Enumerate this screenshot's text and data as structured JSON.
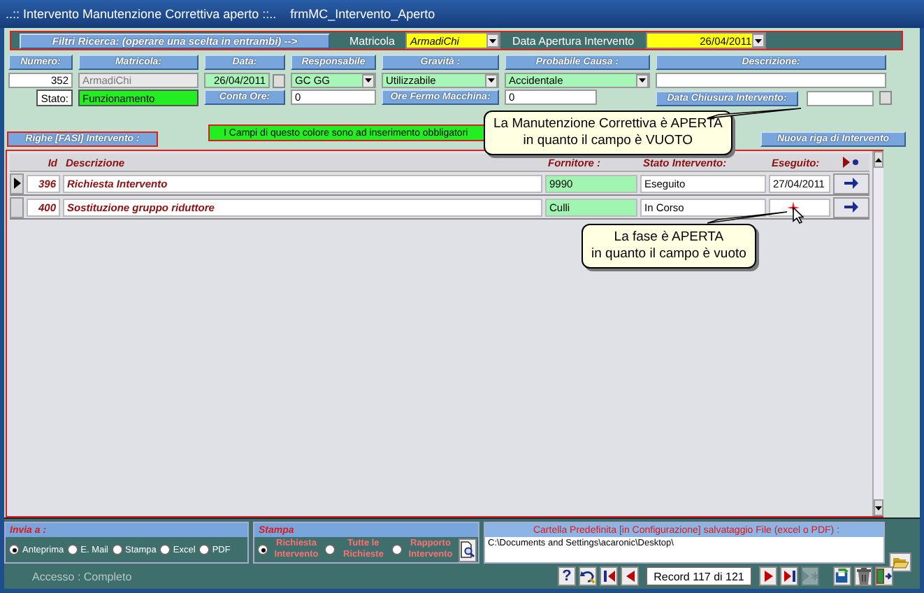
{
  "window": {
    "title": "..::  Intervento Manutenzione Correttiva aperto  ::..",
    "form_name": "frmMC_Intervento_Aperto"
  },
  "filter_bar": {
    "label": "Filtri Ricerca:  (operare una scelta in  entrambi) -->",
    "matricola_label": "Matricola",
    "matricola_value": "ArmadiChi",
    "date_label": "Data Apertura Intervento",
    "date_value": "26/04/2011"
  },
  "header_fields": [
    {
      "label": "Numero:",
      "kind": "number",
      "value": "352",
      "required": false
    },
    {
      "label": "Matricola:",
      "kind": "locked",
      "value": "ArmadiChi",
      "required": false
    },
    {
      "label": "Data:",
      "kind": "date",
      "value": "26/04/2011",
      "required": true
    },
    {
      "label": "Responsabile",
      "kind": "combo",
      "value": "GC GG",
      "required": true
    },
    {
      "label": "Gravità :",
      "kind": "combo",
      "value": "Utilizzabile",
      "required": true
    },
    {
      "label": "Probabile Causa :",
      "kind": "combo",
      "value": "Accidentale",
      "required": true
    },
    {
      "label": "Descrizione:",
      "kind": "text",
      "required": false
    }
  ],
  "status_row": {
    "stato_label": "Stato:",
    "stato_value": "Funzionamento",
    "conta_ore_label": "Conta Ore:",
    "conta_ore_value": "0",
    "ore_fermo_label": "Ore Fermo Macchina:",
    "ore_fermo_value": "0",
    "chiusura_label": "Data Chiusura Intervento:"
  },
  "legend": "I Campi di questo colore sono ad inserimento obbligatori",
  "phases": {
    "label": "Righe [FASI]  Intervento :",
    "new_row_button": "Nuova riga di Intervento",
    "columns": [
      "Id",
      "Descrizione",
      "Fornitore :",
      "Stato Intervento:",
      "Eseguito:"
    ],
    "rows": [
      {
        "selected": true,
        "id": "396",
        "description": "Richiesta Intervento",
        "supplier": "9990",
        "status": "Eseguito",
        "done": "27/04/2011"
      },
      {
        "selected": false,
        "id": "400",
        "description": "Sostituzione gruppo  riduttore",
        "supplier": "Culli",
        "status": "In Corso"
      }
    ]
  },
  "tooltips": [
    {
      "lines": [
        "La Manutenzione Correttiva è APERTA",
        "in quanto il campo è VUOTO"
      ]
    },
    {
      "lines": [
        "La fase è APERTA",
        "in quanto il campo è vuoto"
      ]
    }
  ],
  "send_to": {
    "label": "Invia a :",
    "options": [
      {
        "label": "Anteprima",
        "selected": true
      },
      {
        "label": "E. Mail",
        "selected": false
      },
      {
        "label": "Stampa",
        "selected": false
      },
      {
        "label": "Excel",
        "selected": false
      },
      {
        "label": "PDF",
        "selected": false
      }
    ]
  },
  "print": {
    "label": "Stampa",
    "options": [
      {
        "label": "Richiesta Intervento",
        "selected": true
      },
      {
        "label": "Tutte le Richieste",
        "selected": false
      },
      {
        "label": "Rapporto Intervento",
        "selected": false
      }
    ]
  },
  "folder": {
    "label": "Cartella Predefinita  [in Configurazione] salvataggio File (excel o PDF) :",
    "value": "C:\\Documents and Settings\\acaronic\\Desktop\\"
  },
  "status_bar": {
    "access": "Accesso : Completo",
    "record": "Record 117 di 121",
    "nav_left": [
      {
        "kind": "help",
        "label": "?",
        "disabled": false
      },
      {
        "kind": "undo",
        "disabled": false
      },
      {
        "kind": "first",
        "disabled": false
      },
      {
        "kind": "prev",
        "disabled": false
      }
    ],
    "nav_right": [
      {
        "kind": "next",
        "disabled": false
      },
      {
        "kind": "last",
        "disabled": false
      },
      {
        "kind": "new",
        "disabled": true
      }
    ],
    "actions": [
      {
        "kind": "save",
        "disabled": false
      },
      {
        "kind": "delete",
        "disabled": false
      },
      {
        "kind": "exit",
        "disabled": false
      }
    ]
  }
}
